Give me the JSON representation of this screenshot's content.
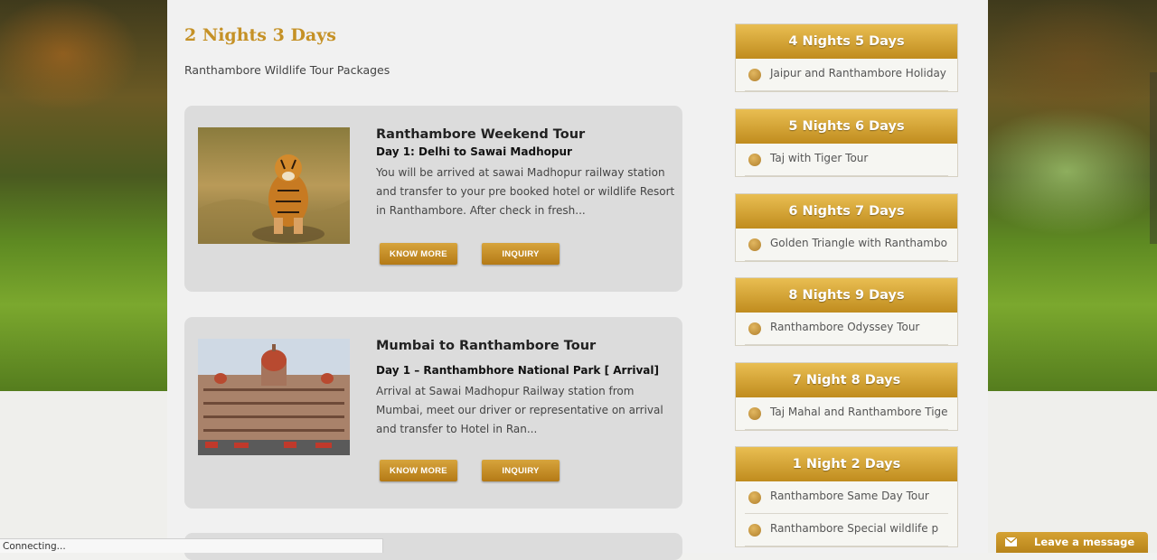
{
  "page": {
    "title": "2 Nights 3 Days",
    "subtitle": "Ranthambore Wildlife Tour Packages"
  },
  "tours": [
    {
      "name": "Ranthambore Weekend Tour",
      "day": "Day 1:  Delhi to Sawai Madhopur",
      "description": "You will be arrived at sawai Madhopur railway station and transfer to your pre booked hotel or wildlife Resort in Ranthambore. After check in fresh...",
      "image": "tiger-photo",
      "know_more": "KNOW MORE",
      "inquiry": "INQUIRY"
    },
    {
      "name": "Mumbai to Ranthambore Tour",
      "day": "Day 1 –  Ranthambhore National Park [ Arrival]",
      "description": "Arrival at Sawai Madhopur Railway station from Mumbai, meet our driver or representative on arrival and transfer to Hotel in Ran...",
      "image": "taj-mahal-palace-hotel-photo",
      "know_more": "KNOW MORE",
      "inquiry": "INQUIRY"
    }
  ],
  "sidebar": [
    {
      "heading": "4 Nights 5 Days",
      "items": [
        "Jaipur and Ranthambore Holiday"
      ]
    },
    {
      "heading": "5 Nights 6 Days",
      "items": [
        "Taj with Tiger Tour"
      ]
    },
    {
      "heading": "6 Nights 7 Days",
      "items": [
        "Golden Triangle with Ranthambo"
      ]
    },
    {
      "heading": "8 Nights 9 Days",
      "items": [
        "Ranthambore Odyssey Tour"
      ]
    },
    {
      "heading": "7 Night 8 Days",
      "items": [
        "Taj Mahal and Ranthambore Tige"
      ]
    },
    {
      "heading": "1 Night 2 Days",
      "items": [
        "Ranthambore Same Day Tour",
        "Ranthambore Special wildlife p"
      ]
    }
  ],
  "status_bar": {
    "text": "Connecting..."
  },
  "chat": {
    "label": "Leave a message",
    "icon": "mail-icon"
  },
  "colors": {
    "accent": "#c59126",
    "button": "#c8901f",
    "card": "#dcdcdc"
  }
}
